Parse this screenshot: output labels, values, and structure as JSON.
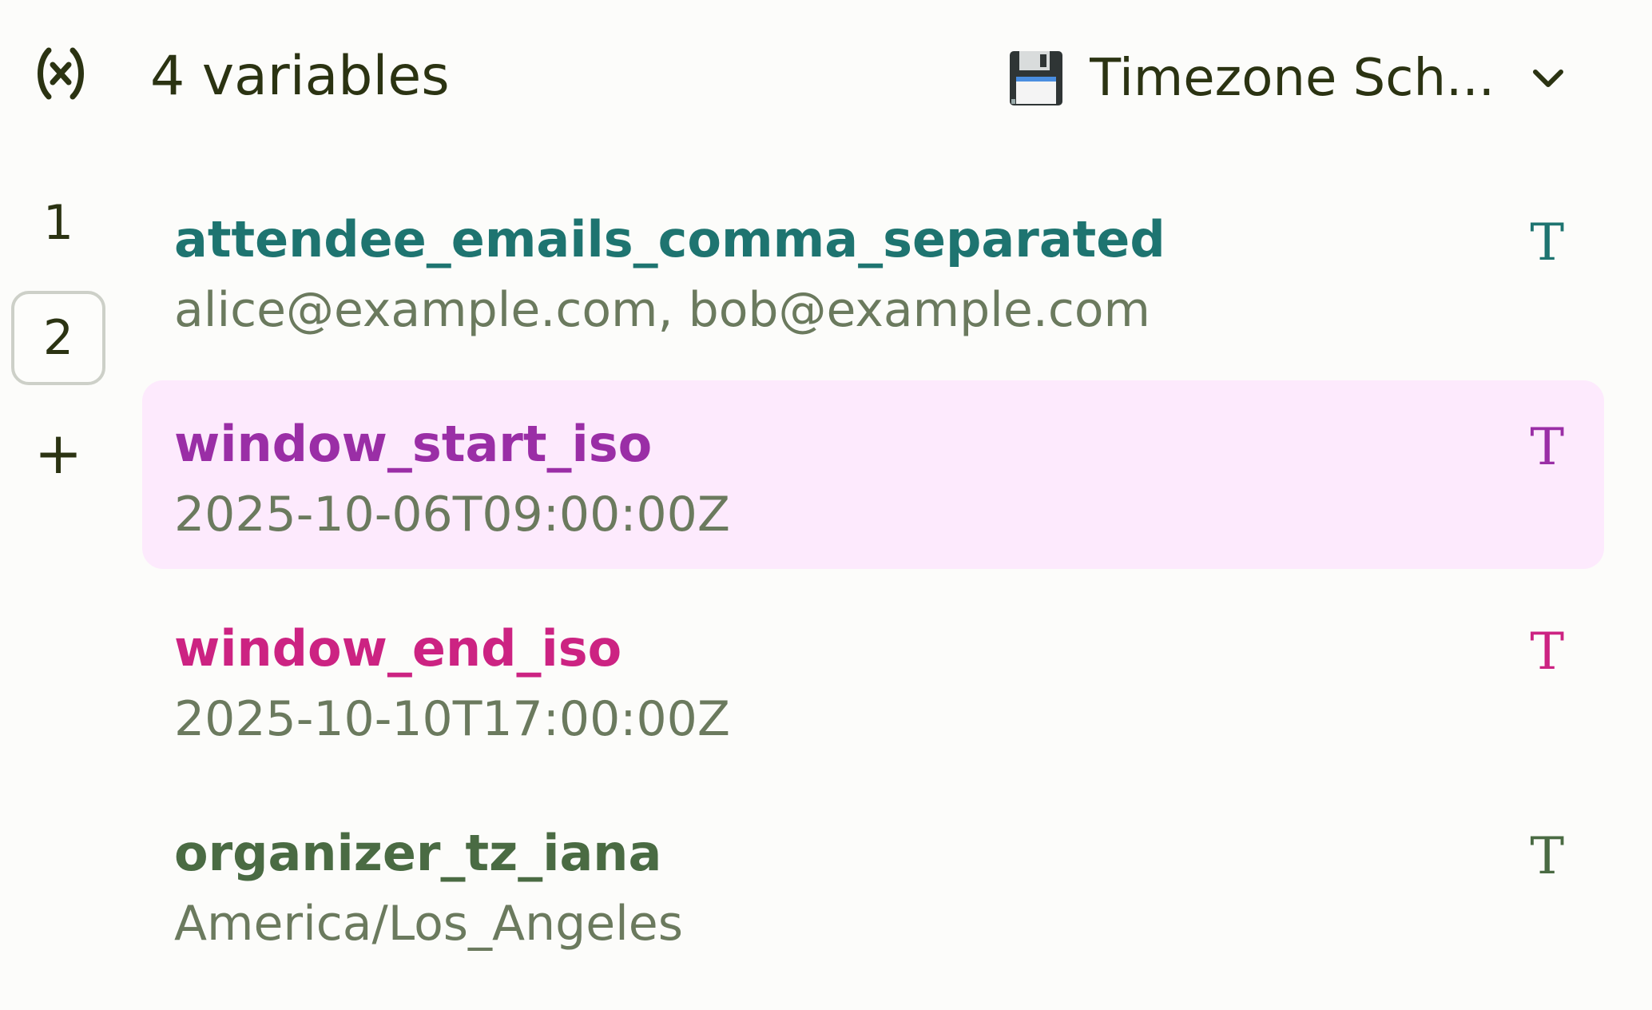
{
  "header": {
    "variables_icon": "variable-icon",
    "count_label": "4 variables",
    "file_select": {
      "icon": "floppy-disk-icon",
      "label": "Timezone Sch...",
      "chevron_icon": "chevron-down-icon"
    }
  },
  "rail": {
    "items": [
      {
        "label": "1",
        "selected": false
      },
      {
        "label": "2",
        "selected": true
      }
    ],
    "add_label": "+"
  },
  "variables": [
    {
      "name": "attendee_emails_comma_separated",
      "value": "alice@example.com, bob@example.com",
      "type_icon": "T",
      "color": "#1e7470",
      "highlight": false
    },
    {
      "name": "window_start_iso",
      "value": "2025-10-06T09:00:00Z",
      "type_icon": "T",
      "color": "#9a2ea6",
      "highlight": true
    },
    {
      "name": "window_end_iso",
      "value": "2025-10-10T17:00:00Z",
      "type_icon": "T",
      "color": "#cc2382",
      "highlight": false
    },
    {
      "name": "organizer_tz_iana",
      "value": "America/Los_Angeles",
      "type_icon": "T",
      "color": "#4a6b43",
      "highlight": false
    }
  ],
  "colors": {
    "background": "#fcfcfa",
    "text_primary": "#2b3312",
    "text_secondary": "#6b7a5e",
    "highlight_bg": "#fdeafd",
    "selected_border": "#cdd0c8"
  }
}
